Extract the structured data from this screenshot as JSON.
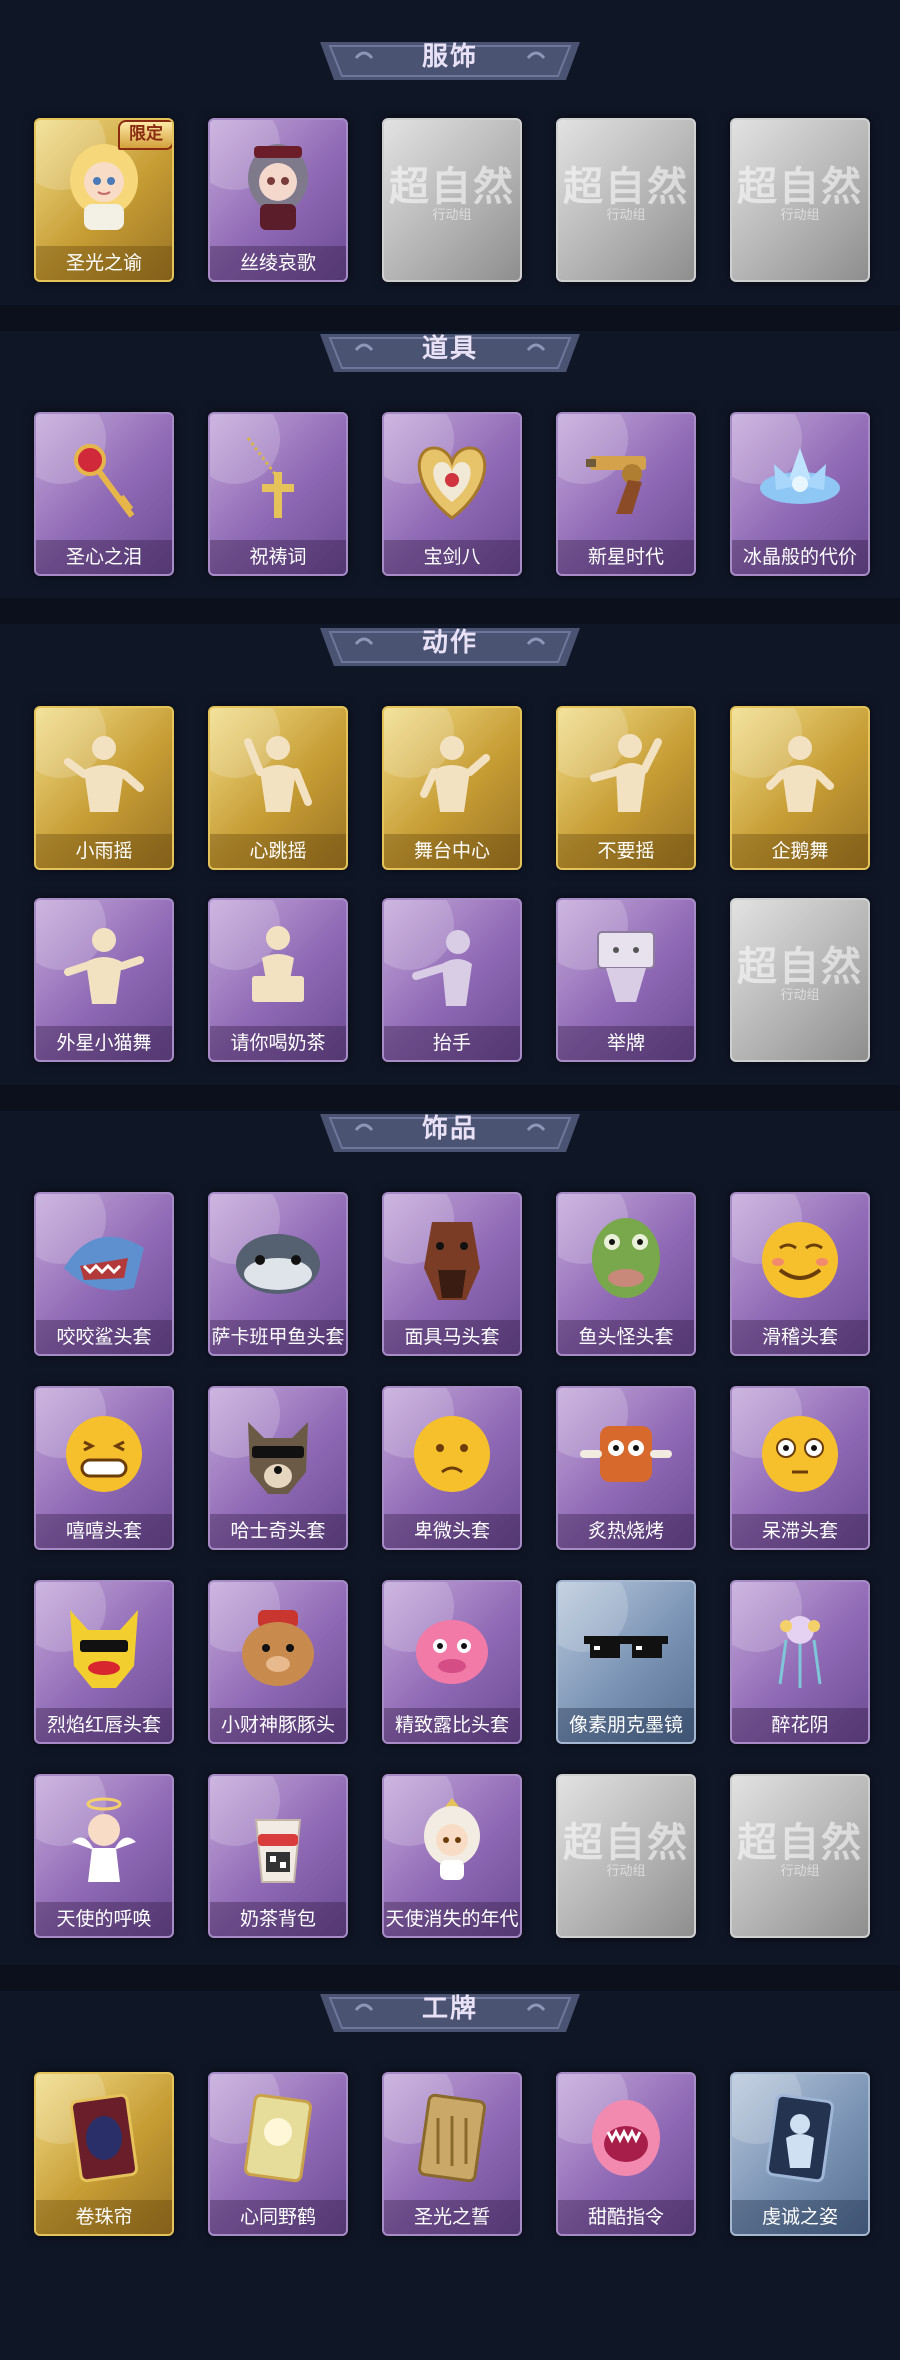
{
  "sections": [
    {
      "title": "服饰"
    },
    {
      "title": "道具"
    },
    {
      "title": "动作"
    },
    {
      "title": "饰品"
    },
    {
      "title": "工牌"
    }
  ],
  "placeholder": {
    "logo": "超自然",
    "sub": "行动组"
  },
  "badge": {
    "limited": "限定"
  },
  "costume": [
    "圣光之谕",
    "丝绫哀歌"
  ],
  "props": [
    "圣心之泪",
    "祝祷词",
    "宝剑八",
    "新星时代",
    "冰晶般的代价"
  ],
  "actions_row1": [
    "小雨摇",
    "心跳摇",
    "舞台中心",
    "不要摇",
    "企鹅舞"
  ],
  "actions_row2": [
    "外星小猫舞",
    "请你喝奶茶",
    "抬手",
    "举牌"
  ],
  "accessories_row1": [
    "咬咬鲨头套",
    "萨卡班甲鱼头套",
    "面具马头套",
    "鱼头怪头套",
    "滑稽头套"
  ],
  "accessories_row2": [
    "嘻嘻头套",
    "哈士奇头套",
    "卑微头套",
    "炙热烧烤",
    "呆滞头套"
  ],
  "accessories_row3": [
    "烈焰红唇头套",
    "小财神豚豚头",
    "精致露比头套",
    "像素朋克墨镜",
    "醉花阴"
  ],
  "accessories_row4": [
    "天使的呼唤",
    "奶茶背包",
    "天使消失的年代"
  ],
  "badges": [
    "卷珠帘",
    "心同野鹤",
    "圣光之誓",
    "甜酷指令",
    "虔诚之姿"
  ],
  "colors": {
    "background": "#0f1626",
    "banner": "#4b5373",
    "purple": "#8e68b4",
    "gold": "#c69c34",
    "silver": "#b5b5b5",
    "blue": "#7a93b4"
  }
}
